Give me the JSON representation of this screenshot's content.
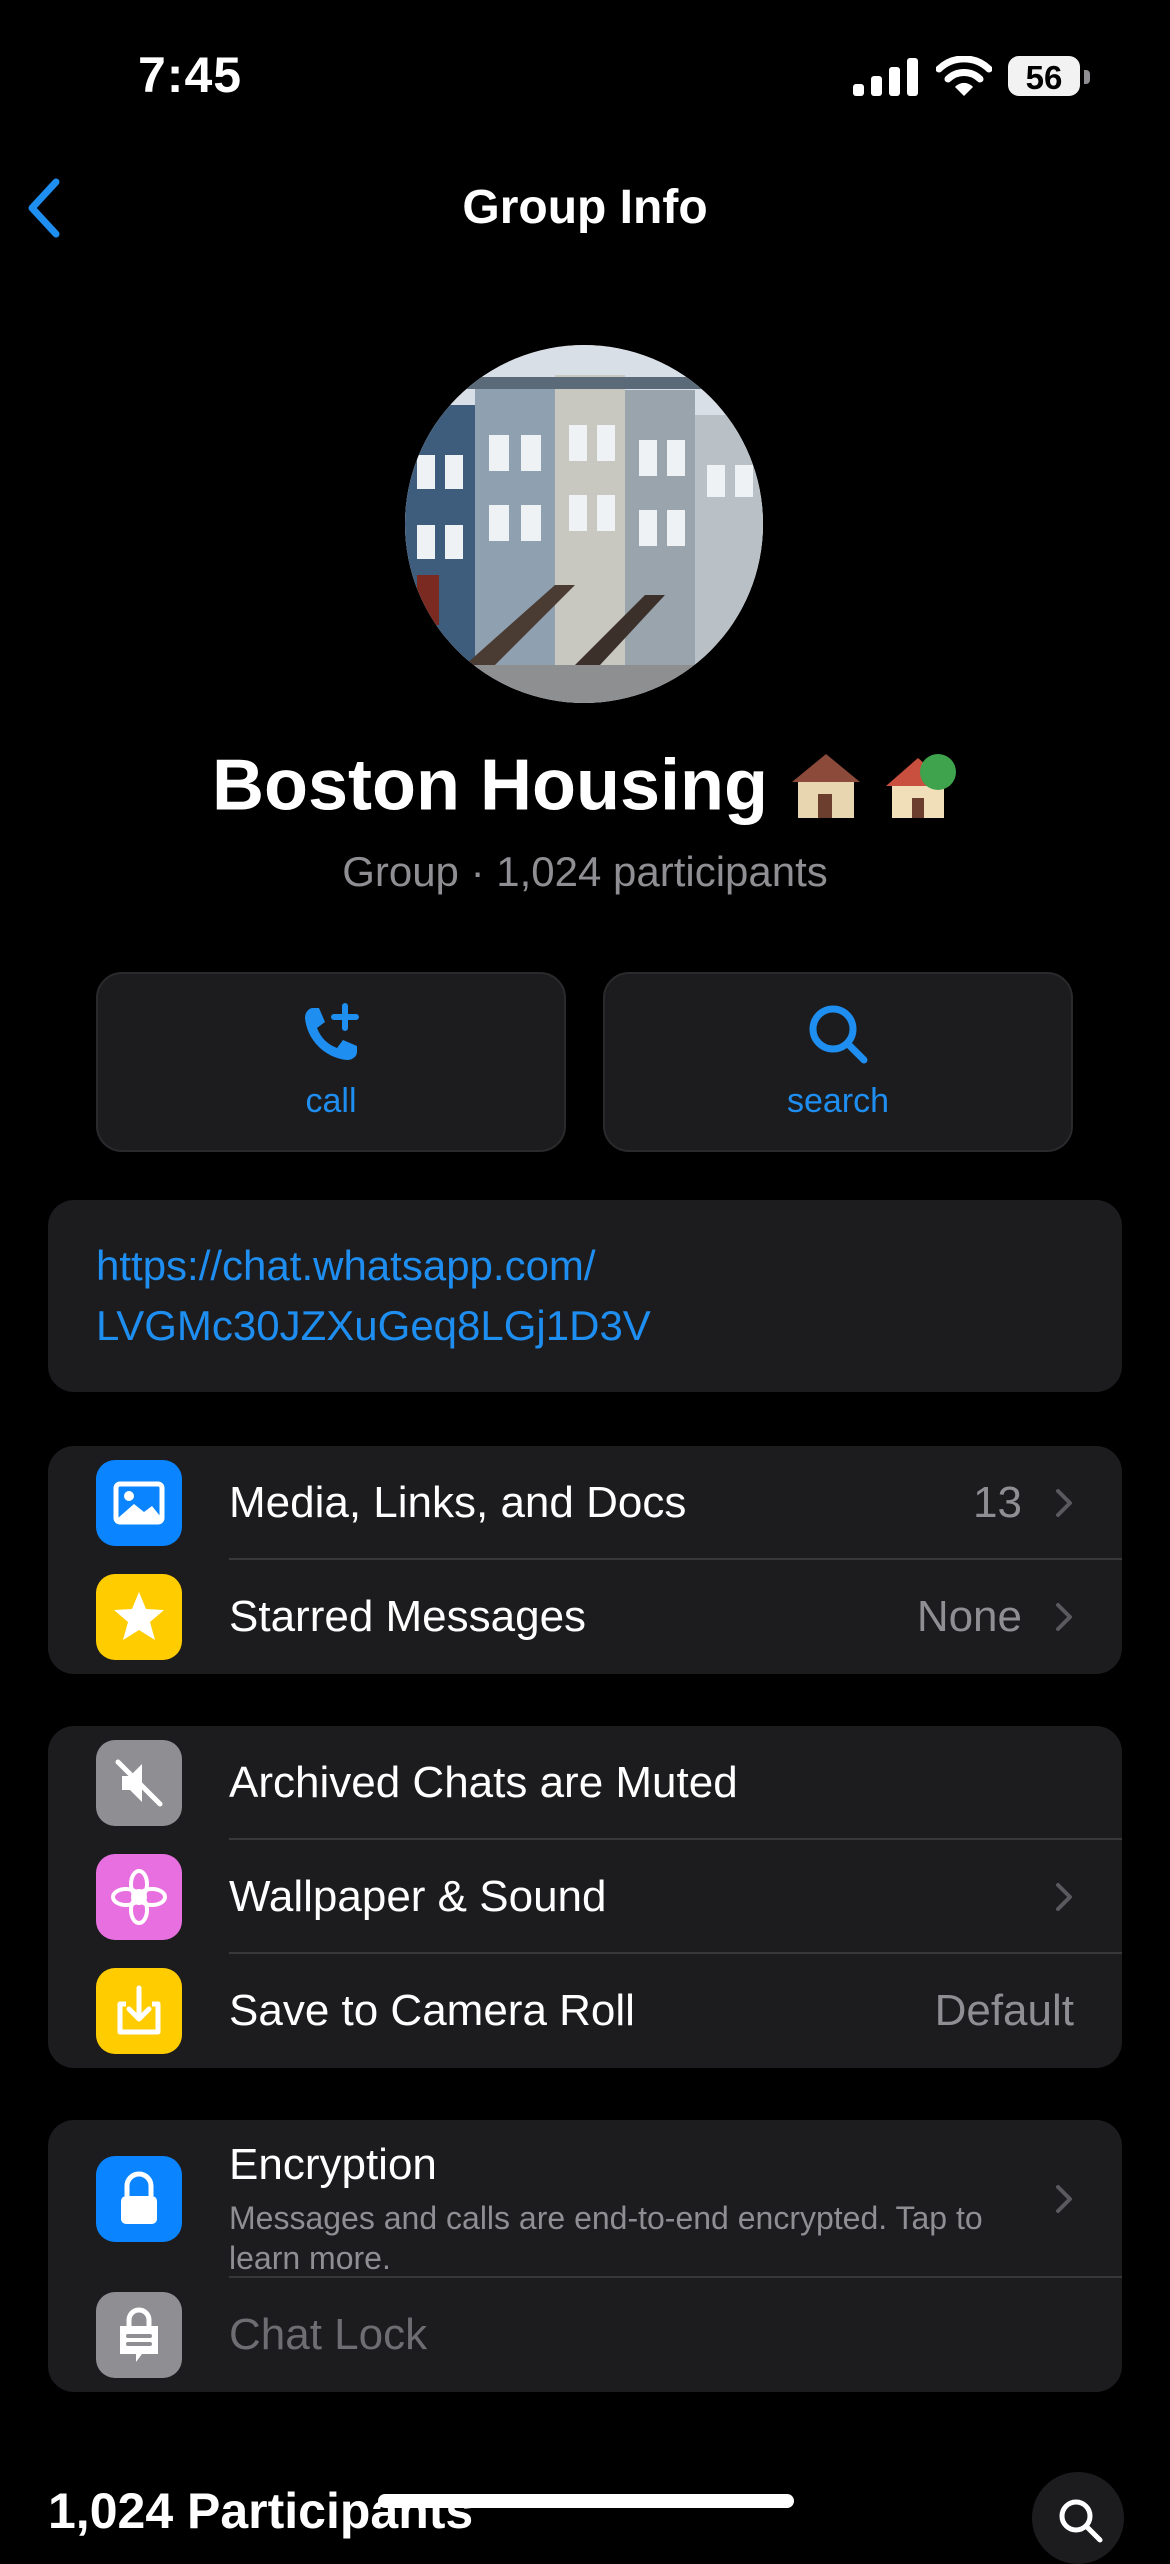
{
  "status_bar": {
    "time": "7:45",
    "battery": "56"
  },
  "nav": {
    "title": "Group Info"
  },
  "group": {
    "name": "Boston Housing",
    "emoji": "🏘️🏡",
    "subtitle": "Group · 1,024 participants"
  },
  "actions": [
    {
      "label": "call",
      "icon": "phone-plus-icon"
    },
    {
      "label": "search",
      "icon": "search-icon"
    }
  ],
  "invite_link": {
    "line1": "https://chat.whatsapp.com/",
    "line2": "LVGMc30JZXuGeq8LGj1D3V"
  },
  "media_section": [
    {
      "label": "Media, Links, and Docs",
      "value": "13",
      "icon": "photo-icon",
      "color": "#0a84ff"
    },
    {
      "label": "Starred Messages",
      "value": "None",
      "icon": "star-icon",
      "color": "#ffcc00"
    }
  ],
  "settings_section": [
    {
      "label": "Archived Chats are Muted",
      "value": "",
      "icon": "muted-speaker-icon",
      "color": "#8e8e93"
    },
    {
      "label": "Wallpaper & Sound",
      "value": "",
      "icon": "flower-icon",
      "color": "#e86fe0"
    },
    {
      "label": "Save to Camera Roll",
      "value": "Default",
      "icon": "download-icon",
      "color": "#ffcc00"
    }
  ],
  "security_section": {
    "encryption": {
      "title": "Encryption",
      "desc": "Messages and calls are end-to-end encrypted. Tap to learn more.",
      "icon": "lock-icon",
      "color": "#0a84ff"
    },
    "chat_lock": {
      "label": "Chat Lock",
      "icon": "chat-lock-icon",
      "color": "#8e8e93"
    }
  },
  "participants": {
    "header": "1,024 Participants"
  },
  "colors": {
    "accent": "#1f8ef1",
    "card": "#1c1c1e",
    "background": "#000000"
  }
}
